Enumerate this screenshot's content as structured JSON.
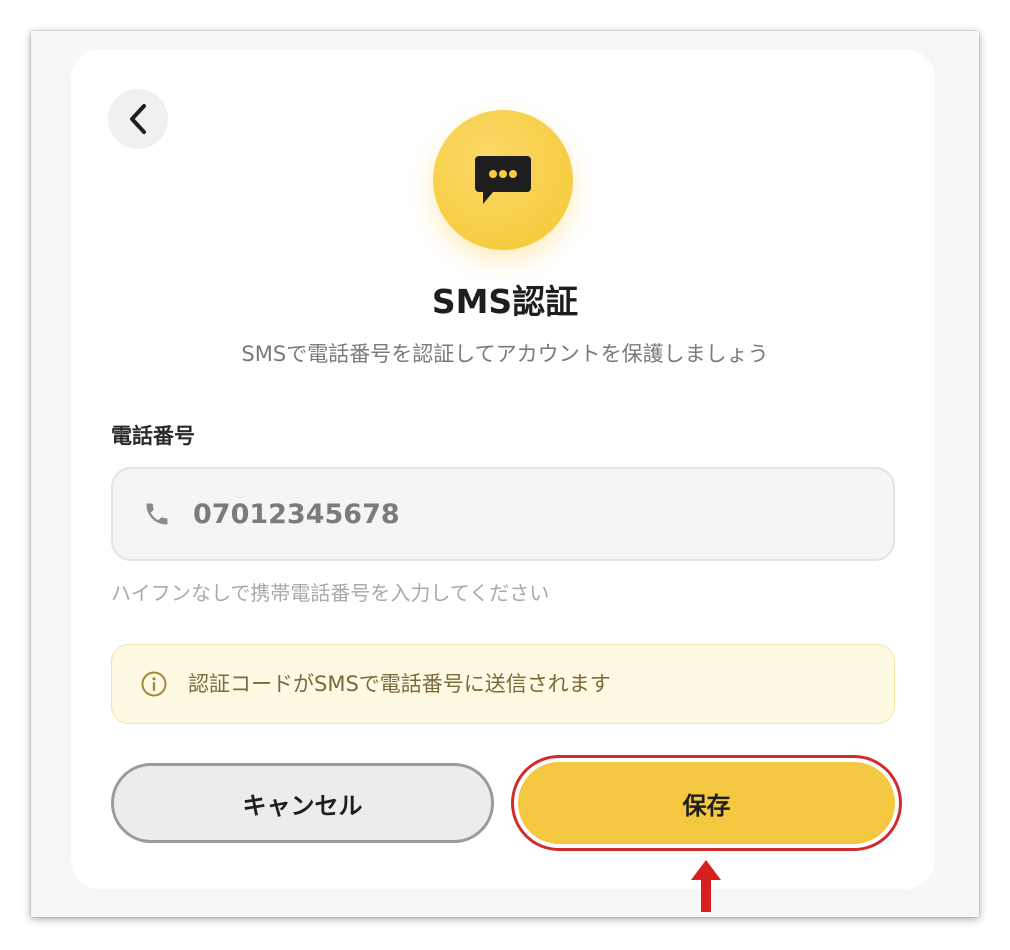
{
  "header": {
    "title": "SMS認証",
    "subtitle": "SMSで電話番号を認証してアカウントを保護しましょう"
  },
  "phone": {
    "label": "電話番号",
    "value": "07012345678",
    "helper": "ハイフンなしで携帯電話番号を入力してください"
  },
  "info": {
    "message": "認証コードがSMSで電話番号に送信されます"
  },
  "actions": {
    "cancel_label": "キャンセル",
    "save_label": "保存"
  },
  "icons": {
    "back": "chevron-left-icon",
    "hero": "chat-bubble-icon",
    "phone": "phone-icon",
    "info": "info-icon",
    "annotation": "up-arrow-icon"
  },
  "colors": {
    "accent": "#f5c842",
    "highlight": "#d22b2b",
    "info_bg": "#fef9e3"
  }
}
